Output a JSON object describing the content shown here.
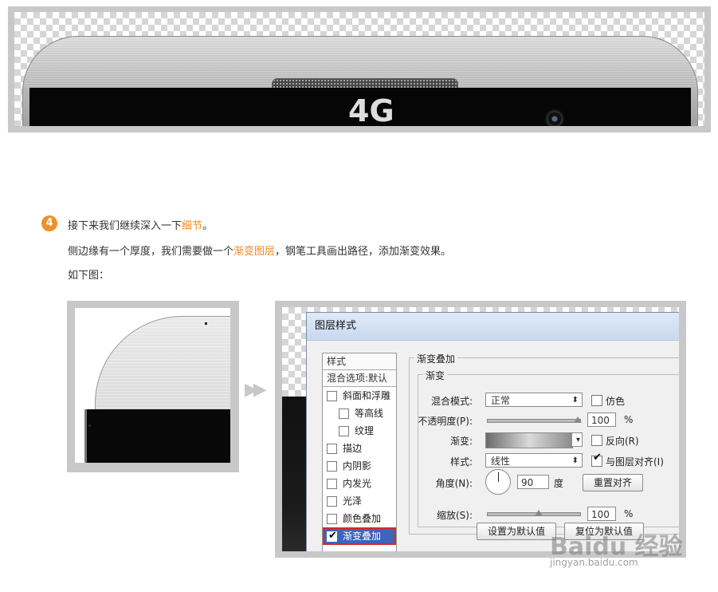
{
  "top_image": {
    "logo_glyph": "4G"
  },
  "step": {
    "number": "4",
    "line1_prefix": "接下来我们继续深入一下",
    "line1_highlight": "细节",
    "line1_suffix": "。",
    "line2_prefix": "侧边缘有一个厚度，我们需要做一个",
    "line2_highlight": "渐变图层",
    "line2_suffix": "，钢笔工具画出路径，添加渐变效果。",
    "line3": "如下图："
  },
  "arrow_glyph": "▶▶",
  "dialog": {
    "title": "图层样式",
    "list_header": "样式",
    "list_blend_options": "混合选项:默认",
    "list_items": [
      {
        "label": "斜面和浮雕",
        "checked": false,
        "indent": false
      },
      {
        "label": "等高线",
        "checked": false,
        "indent": true
      },
      {
        "label": "纹理",
        "checked": false,
        "indent": true
      },
      {
        "label": "描边",
        "checked": false,
        "indent": false
      },
      {
        "label": "内阴影",
        "checked": false,
        "indent": false
      },
      {
        "label": "内发光",
        "checked": false,
        "indent": false
      },
      {
        "label": "光泽",
        "checked": false,
        "indent": false
      },
      {
        "label": "颜色叠加",
        "checked": false,
        "indent": false
      },
      {
        "label": "渐变叠加",
        "checked": true,
        "indent": false
      }
    ],
    "check_glyph": "✔",
    "section_title": "渐变叠加",
    "subsection_title": "渐变",
    "blend_mode_label": "混合模式:",
    "blend_mode_value": "正常",
    "dither_label": "仿色",
    "opacity_label": "不透明度(P):",
    "opacity_value": "100",
    "opacity_level": 1.0,
    "percent": "%",
    "gradient_label": "渐变:",
    "reverse_label": "反向(R)",
    "style_label": "样式:",
    "style_value": "线性",
    "align_label": "与图层对齐(I)",
    "align_checked": true,
    "angle_label": "角度(N):",
    "angle_value": "90",
    "degree_unit": "度",
    "reset_align_button": "重置对齐",
    "scale_label": "缩放(S):",
    "scale_value": "100",
    "scale_level": 0.55,
    "set_default_button": "设置为默认值",
    "reset_default_button": "复位为默认值",
    "caret": "⬍",
    "dropdown_caret": "▾"
  },
  "watermark": {
    "main": "Baidu 经验",
    "sub": "jingyan.baidu.com"
  }
}
